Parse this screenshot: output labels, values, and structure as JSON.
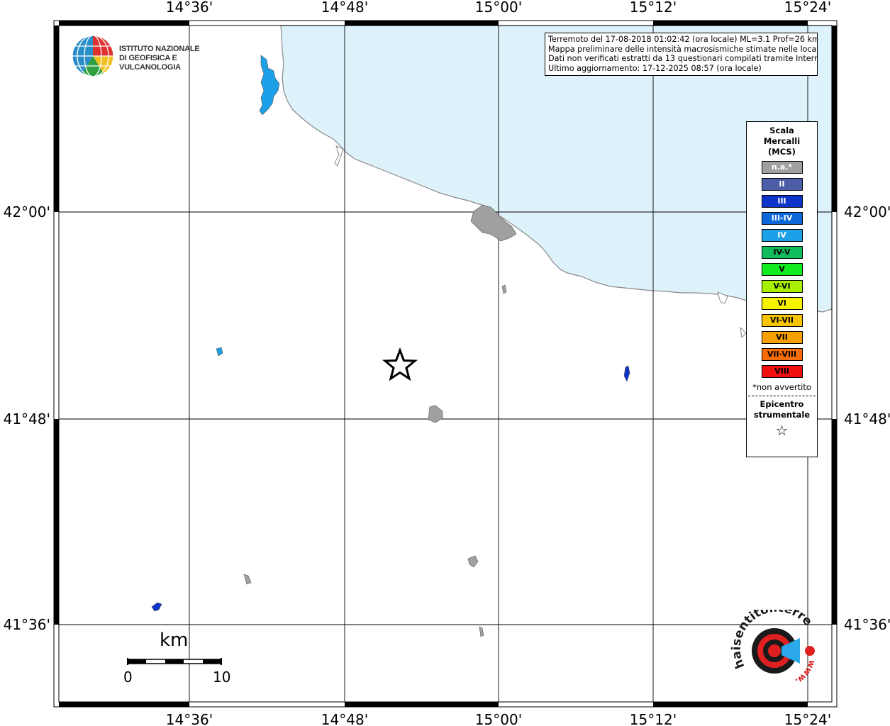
{
  "map": {
    "title_lines": [
      "Terremoto del 17-08-2018 01:02:42 (ora locale) ML=3.1 Prof=26 km",
      "Mappa preliminare delle intensità macrosismiche stimate nelle località",
      "Dati non verificati estratti da 13 questionari compilati tramite Internet.",
      "Ultimo aggiornamento: 17-12-2025 08:57 (ora locale)"
    ],
    "lon_ticks": [
      "14°36'",
      "14°48'",
      "15°00'",
      "15°12'",
      "15°24'"
    ],
    "lat_ticks": [
      "42°00'",
      "41°48'",
      "41°36'"
    ],
    "colors": {
      "sea": "#def2fc",
      "land": "#ffffff",
      "coast": "#888888",
      "grid": "#000000",
      "na": "#a0a0a0"
    },
    "logo_ingv": {
      "lines": [
        "ISTITUTO NAZIONALE",
        "DI GEOFISICA E VULCANOLOGIA"
      ],
      "icon": "ingv-globe-icon"
    },
    "logo_hsl": {
      "text": "haisentitoilterremoto.it",
      "sub": "www.",
      "icon": "hsl-target-icon"
    },
    "scale_bar": {
      "title": "km",
      "min": "0",
      "max": "10"
    },
    "epicenter": {
      "icon": "star-icon"
    }
  },
  "legend": {
    "title": [
      "Scala",
      "Mercalli",
      "(MCS)"
    ],
    "items": [
      {
        "label": "n.a.*",
        "color": "#a0a0a0",
        "text_color": "#ffffff"
      },
      {
        "label": "II",
        "color": "#4c5ea8",
        "text_color": "#ffffff"
      },
      {
        "label": "III",
        "color": "#0c34c8",
        "text_color": "#ffffff"
      },
      {
        "label": "III-IV",
        "color": "#0c68d8",
        "text_color": "#ffffff"
      },
      {
        "label": "IV",
        "color": "#1ca0e8",
        "text_color": "#ffffff"
      },
      {
        "label": "IV-V",
        "color": "#10bc5c",
        "text_color": "#000000"
      },
      {
        "label": "V",
        "color": "#10ec20",
        "text_color": "#000000"
      },
      {
        "label": "V-VI",
        "color": "#a8f000",
        "text_color": "#000000"
      },
      {
        "label": "VI",
        "color": "#f8f400",
        "text_color": "#000000"
      },
      {
        "label": "VI-VII",
        "color": "#f8c400",
        "text_color": "#000000"
      },
      {
        "label": "VII",
        "color": "#f8a000",
        "text_color": "#000000"
      },
      {
        "label": "VII-VIII",
        "color": "#f86c08",
        "text_color": "#000000"
      },
      {
        "label": "VIII",
        "color": "#f01010",
        "text_color": "#000000"
      }
    ],
    "note": "*non avvertito",
    "epicenter_label": [
      "Epicentro",
      "strumentale"
    ],
    "epicenter_symbol": "☆"
  }
}
